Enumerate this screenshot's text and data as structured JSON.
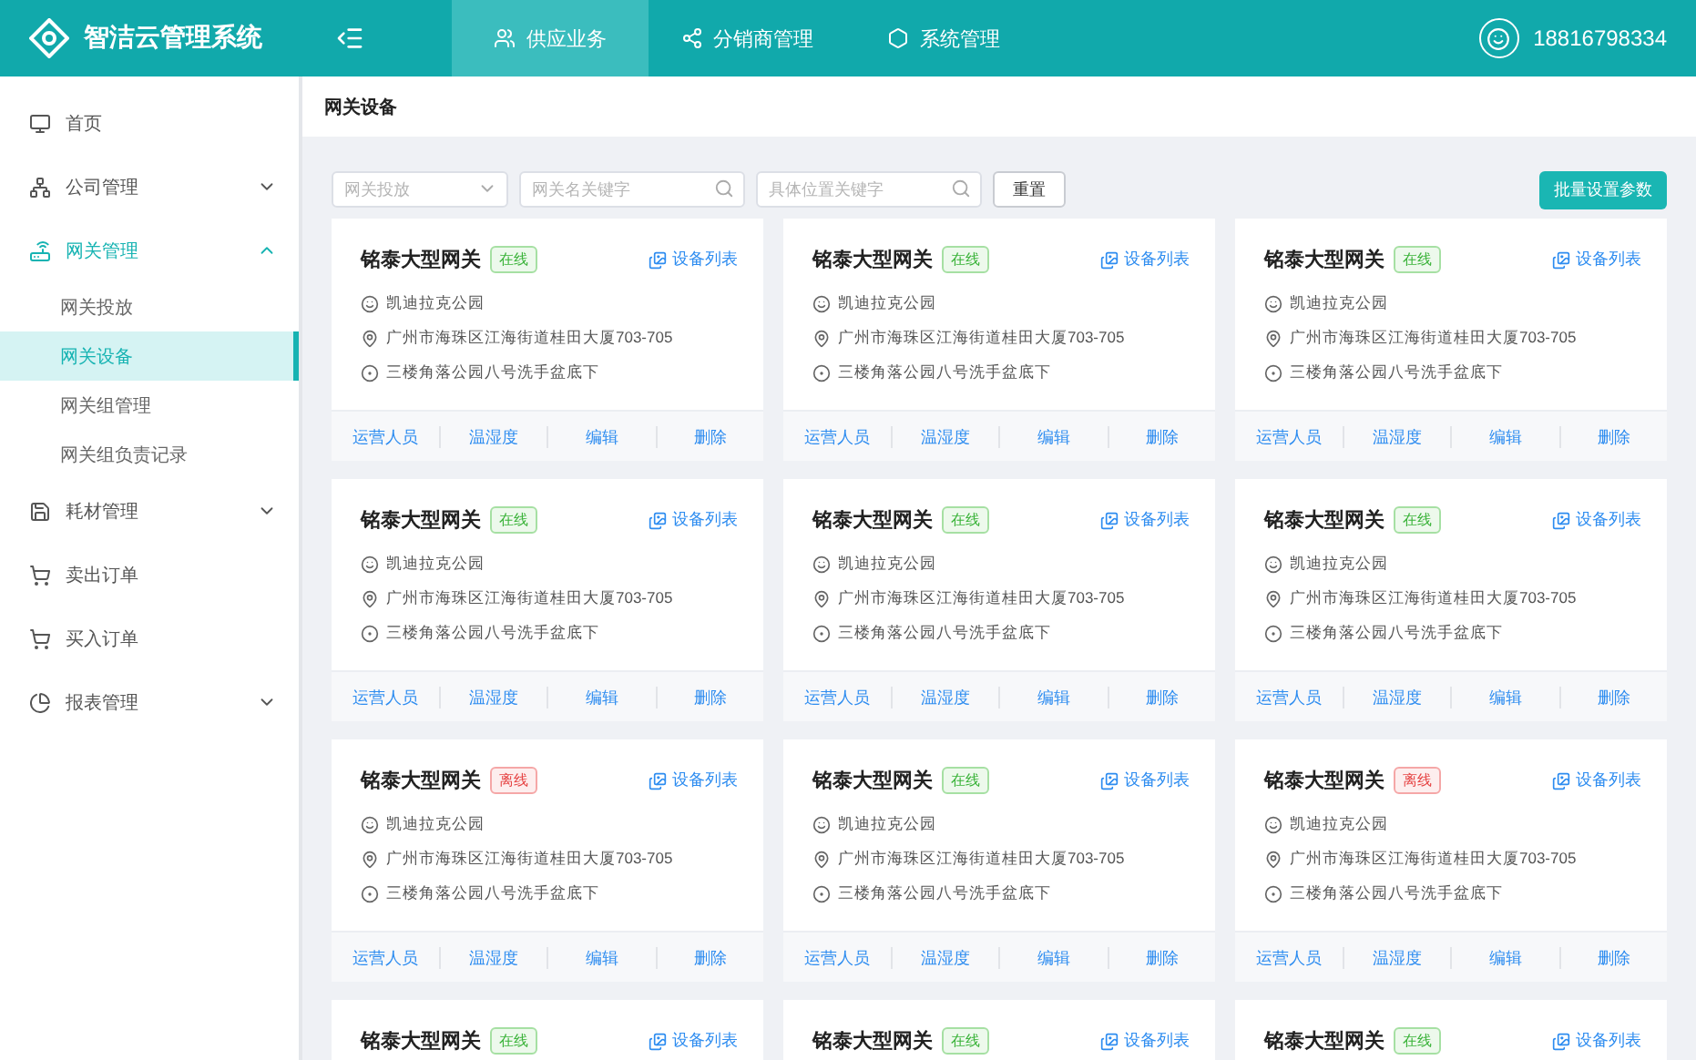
{
  "header": {
    "title": "智洁云管理系统",
    "nav": [
      {
        "label": "供应业务",
        "kind": "supply",
        "selected": true
      },
      {
        "label": "分销商管理",
        "kind": "distributor",
        "selected": false
      },
      {
        "label": "系统管理",
        "kind": "system",
        "selected": false
      }
    ],
    "user": "18816798334"
  },
  "sidebar": {
    "items": [
      {
        "label": "首页",
        "kind": "home",
        "selected": false
      },
      {
        "label": "公司管理",
        "kind": "company",
        "expanded": false,
        "selected": false
      },
      {
        "label": "网关管理",
        "kind": "gateway",
        "expanded": true,
        "selected": true,
        "children": [
          {
            "label": "网关投放",
            "selected": false
          },
          {
            "label": "网关设备",
            "selected": true
          },
          {
            "label": "网关组管理",
            "selected": false
          },
          {
            "label": "网关组负责记录",
            "selected": false
          }
        ]
      },
      {
        "label": "耗材管理",
        "kind": "supplies",
        "expanded": false,
        "selected": false
      },
      {
        "label": "卖出订单",
        "kind": "sell",
        "selected": false
      },
      {
        "label": "买入订单",
        "kind": "buy",
        "selected": false
      },
      {
        "label": "报表管理",
        "kind": "report",
        "expanded": false,
        "selected": false
      }
    ]
  },
  "page_title": "网关设备",
  "filters": {
    "select": {
      "placeholder": "网关投放"
    },
    "name_search": {
      "placeholder": "网关名关键字"
    },
    "location_search": {
      "placeholder": "具体位置关键字"
    },
    "reset": "重置",
    "batch": "批量设置参数"
  },
  "cards": [
    {
      "name": "铭泰大型网关",
      "status": "在线",
      "online": true,
      "link": "设备列表",
      "place": "凯迪拉克公园",
      "address": "广州市海珠区江海街道桂田大厦703-705",
      "position": "三楼角落公园八号洗手盆底下",
      "actions": [
        "运营人员",
        "温湿度",
        "编辑",
        "删除"
      ]
    },
    {
      "name": "铭泰大型网关",
      "status": "在线",
      "online": true,
      "link": "设备列表",
      "place": "凯迪拉克公园",
      "address": "广州市海珠区江海街道桂田大厦703-705",
      "position": "三楼角落公园八号洗手盆底下",
      "actions": [
        "运营人员",
        "温湿度",
        "编辑",
        "删除"
      ]
    },
    {
      "name": "铭泰大型网关",
      "status": "在线",
      "online": true,
      "link": "设备列表",
      "place": "凯迪拉克公园",
      "address": "广州市海珠区江海街道桂田大厦703-705",
      "position": "三楼角落公园八号洗手盆底下",
      "actions": [
        "运营人员",
        "温湿度",
        "编辑",
        "删除"
      ]
    },
    {
      "name": "铭泰大型网关",
      "status": "在线",
      "online": true,
      "link": "设备列表",
      "place": "凯迪拉克公园",
      "address": "广州市海珠区江海街道桂田大厦703-705",
      "position": "三楼角落公园八号洗手盆底下",
      "actions": [
        "运营人员",
        "温湿度",
        "编辑",
        "删除"
      ]
    },
    {
      "name": "铭泰大型网关",
      "status": "在线",
      "online": true,
      "link": "设备列表",
      "place": "凯迪拉克公园",
      "address": "广州市海珠区江海街道桂田大厦703-705",
      "position": "三楼角落公园八号洗手盆底下",
      "actions": [
        "运营人员",
        "温湿度",
        "编辑",
        "删除"
      ]
    },
    {
      "name": "铭泰大型网关",
      "status": "在线",
      "online": true,
      "link": "设备列表",
      "place": "凯迪拉克公园",
      "address": "广州市海珠区江海街道桂田大厦703-705",
      "position": "三楼角落公园八号洗手盆底下",
      "actions": [
        "运营人员",
        "温湿度",
        "编辑",
        "删除"
      ]
    },
    {
      "name": "铭泰大型网关",
      "status": "离线",
      "online": false,
      "link": "设备列表",
      "place": "凯迪拉克公园",
      "address": "广州市海珠区江海街道桂田大厦703-705",
      "position": "三楼角落公园八号洗手盆底下",
      "actions": [
        "运营人员",
        "温湿度",
        "编辑",
        "删除"
      ]
    },
    {
      "name": "铭泰大型网关",
      "status": "在线",
      "online": true,
      "link": "设备列表",
      "place": "凯迪拉克公园",
      "address": "广州市海珠区江海街道桂田大厦703-705",
      "position": "三楼角落公园八号洗手盆底下",
      "actions": [
        "运营人员",
        "温湿度",
        "编辑",
        "删除"
      ]
    },
    {
      "name": "铭泰大型网关",
      "status": "离线",
      "online": false,
      "link": "设备列表",
      "place": "凯迪拉克公园",
      "address": "广州市海珠区江海街道桂田大厦703-705",
      "position": "三楼角落公园八号洗手盆底下",
      "actions": [
        "运营人员",
        "温湿度",
        "编辑",
        "删除"
      ]
    },
    {
      "name": "铭泰大型网关",
      "status": "在线",
      "online": true,
      "link": "设备列表"
    },
    {
      "name": "铭泰大型网关",
      "status": "在线",
      "online": true,
      "link": "设备列表"
    },
    {
      "name": "铭泰大型网关",
      "status": "在线",
      "online": true,
      "link": "设备列表"
    }
  ]
}
